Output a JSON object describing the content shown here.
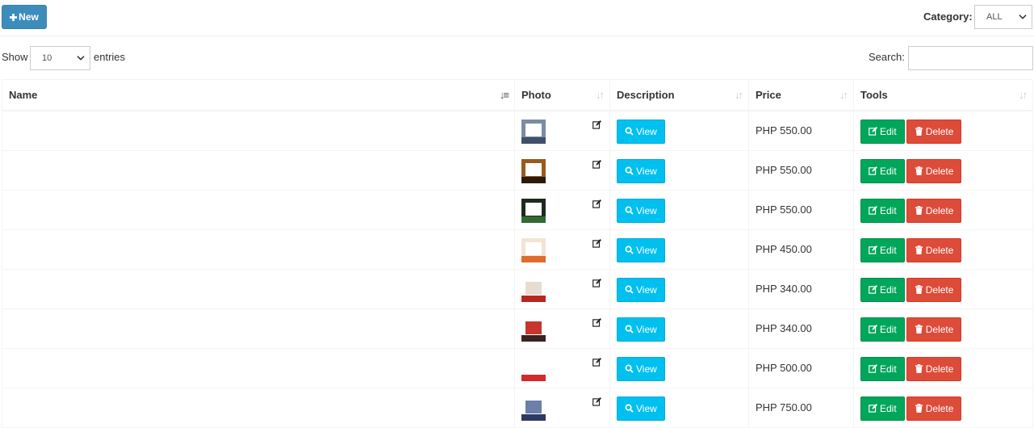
{
  "toolbar": {
    "new_label": "New",
    "category_label": "Category:",
    "category_selected": "ALL"
  },
  "controls": {
    "show_label": "Show",
    "page_size": "10",
    "entries_label": "entries",
    "search_label": "Search:",
    "search_value": ""
  },
  "table": {
    "columns": [
      "Name",
      "Photo",
      "Description",
      "Price",
      "Tools"
    ],
    "sorted_column": "Name",
    "rows": [
      {
        "name": "",
        "price": "PHP 550.00",
        "thumb": [
          "#7b8ba8",
          "#ffffff",
          "#41506a"
        ]
      },
      {
        "name": "",
        "price": "PHP 550.00",
        "thumb": [
          "#9a5a1c",
          "#ffffff",
          "#2b1a0a"
        ]
      },
      {
        "name": "",
        "price": "PHP 550.00",
        "thumb": [
          "#1d2b1d",
          "#ffffff",
          "#2f6b33"
        ]
      },
      {
        "name": "",
        "price": "PHP 450.00",
        "thumb": [
          "#f2e3d5",
          "#ffffff",
          "#e06b2a"
        ]
      },
      {
        "name": "",
        "price": "PHP 340.00",
        "thumb": [
          "#ffffff",
          "#e8dcd2",
          "#b8261f"
        ]
      },
      {
        "name": "",
        "price": "PHP 340.00",
        "thumb": [
          "#ffffff",
          "#c7362c",
          "#3a2322"
        ]
      },
      {
        "name": "",
        "price": "PHP 500.00",
        "thumb": [
          "#ffffff",
          "#ffffff",
          "#d12a2a"
        ]
      },
      {
        "name": "",
        "price": "PHP 750.00",
        "thumb": [
          "#ffffff",
          "#6d7ea8",
          "#2c3a63"
        ]
      }
    ],
    "view_label": "View",
    "edit_label": "Edit",
    "delete_label": "Delete"
  },
  "colors": {
    "primary": "#3c8dbc",
    "info": "#00c0ef",
    "success": "#00a65a",
    "danger": "#dd4b39"
  },
  "icons": {
    "new": "plus-icon",
    "view": "search-icon",
    "edit": "edit-icon",
    "delete": "trash-icon",
    "photo_edit": "edit-icon",
    "sort": "sort-icon"
  }
}
